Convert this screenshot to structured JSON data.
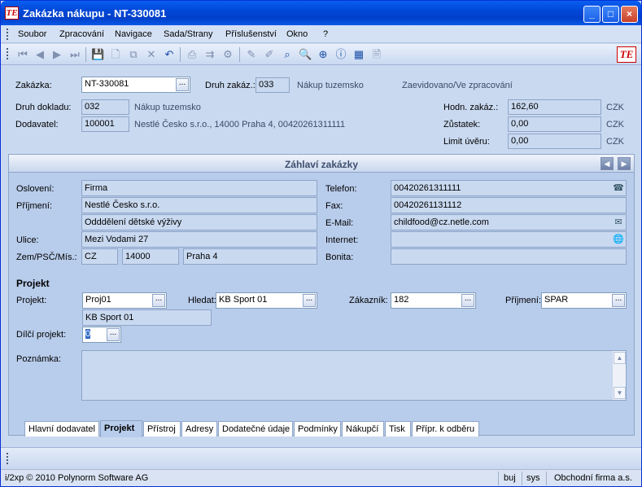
{
  "window": {
    "title": "Zakázka nákupu - NT-330081",
    "app_icon": "TE",
    "minimize": "_",
    "maximize": "□",
    "close": "×"
  },
  "menu": [
    "Soubor",
    "Zpracování",
    "Navigace",
    "Sada/Strany",
    "Příslušenství",
    "Okno",
    "?"
  ],
  "icons": [
    "first-icon",
    "prev-icon",
    "next-icon",
    "last-icon",
    "save-icon",
    "new-icon",
    "copy-icon",
    "delete-icon",
    "undo-icon",
    "print-icon",
    "export-icon",
    "settings-icon",
    "pen-icon",
    "highlight-icon",
    "search-icon",
    "zoom-icon",
    "zoom-reset-icon",
    "info-icon",
    "calculator-icon",
    "document-lock-icon"
  ],
  "header": {
    "zakazka_label": "Zakázka:",
    "zakazka_value": "NT-330081",
    "druh_zakaz_label": "Druh zakáz.:",
    "druh_zakaz_value": "033",
    "druh_zakaz_text": "Nákup tuzemsko",
    "status_text": "Zaevidovano/Ve zpracování",
    "druh_dokladu_label": "Druh dokladu:",
    "druh_dokladu_value": "032",
    "druh_dokladu_text": "Nákup tuzemsko",
    "dodavatel_label": "Dodavatel:",
    "dodavatel_value": "100001",
    "dodavatel_text": "Nestlé Česko s.r.o., 14000 Praha 4, 00420261311111",
    "hodn_label": "Hodn. zakáz.:",
    "hodn_value": "162,60",
    "zustatek_label": "Zůstatek:",
    "zustatek_value": "0,00",
    "limit_label": "Limit úvěru:",
    "limit_value": "0,00",
    "currency": "CZK"
  },
  "panel": {
    "title": "Záhlaví zakázky",
    "prev": "◀",
    "next": "▶",
    "osloveni_label": "Oslovení:",
    "osloveni_value": "Firma",
    "prijmeni_label": "Příjmení:",
    "prijmeni_value": "Nestlé Česko s.r.o.",
    "prijmeni2_value": "Odddělení dětské výživy",
    "ulice_label": "Ulice:",
    "ulice_value": "Mezi Vodami 27",
    "zem_label": "Zem/PSČ/Mís.:",
    "zem_value": "CZ",
    "psc_value": "14000",
    "misto_value": "Praha 4",
    "telefon_label": "Telefon:",
    "telefon_value": "00420261311111",
    "fax_label": "Fax:",
    "fax_value": "00420261131112",
    "email_label": "E-Mail:",
    "email_value": "childfood@cz.netle.com",
    "internet_label": "Internet:",
    "internet_value": "",
    "bonita_label": "Bonita:",
    "bonita_value": "",
    "projekt_section": "Projekt",
    "projekt_label": "Projekt:",
    "projekt_value": "Proj01",
    "projekt_text": "KB Sport 01",
    "hledat_label": "Hledat:",
    "hledat_value": "KB Sport 01",
    "zakaznik_label": "Zákazník:",
    "zakaznik_value": "182",
    "prijmeni_p_label": "Příjmení:",
    "prijmeni_p_value": "SPAR",
    "dilci_label": "Dílčí projekt:",
    "dilci_value": "0",
    "poznamka_label": "Poznámka:",
    "dots": "..."
  },
  "tabs": [
    "Hlavní dodavatel",
    "Projekt",
    "Přístroj",
    "Adresy",
    "Dodatečné údaje",
    "Podmínky",
    "Nákupčí",
    "Tisk",
    "Přípr. k odběru"
  ],
  "status": {
    "copyright": "i/2xp © 2010 Polynorm Software AG",
    "user": "buj",
    "system": "sys",
    "company": "Obchodní firma a.s."
  }
}
